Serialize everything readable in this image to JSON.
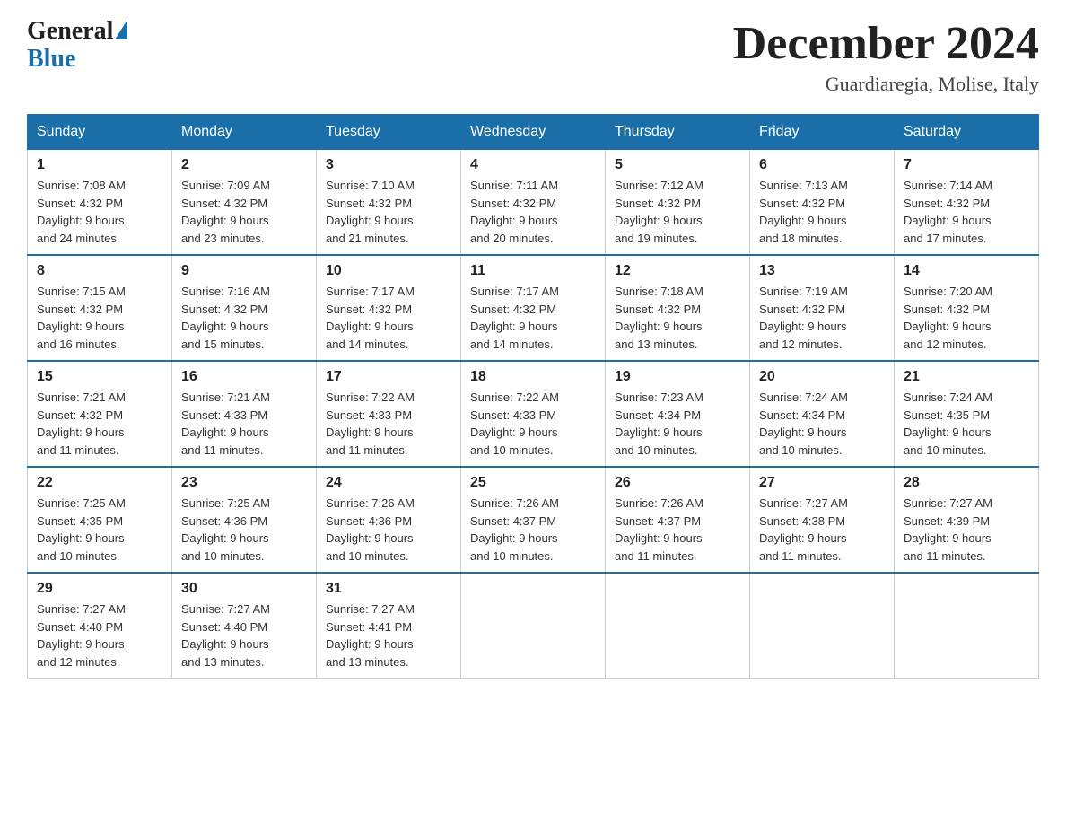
{
  "header": {
    "logo_general": "General",
    "logo_blue": "Blue",
    "month_title": "December 2024",
    "location": "Guardiaregia, Molise, Italy"
  },
  "days_of_week": [
    "Sunday",
    "Monday",
    "Tuesday",
    "Wednesday",
    "Thursday",
    "Friday",
    "Saturday"
  ],
  "weeks": [
    [
      {
        "day": "1",
        "sunrise": "7:08 AM",
        "sunset": "4:32 PM",
        "daylight": "9 hours and 24 minutes."
      },
      {
        "day": "2",
        "sunrise": "7:09 AM",
        "sunset": "4:32 PM",
        "daylight": "9 hours and 23 minutes."
      },
      {
        "day": "3",
        "sunrise": "7:10 AM",
        "sunset": "4:32 PM",
        "daylight": "9 hours and 21 minutes."
      },
      {
        "day": "4",
        "sunrise": "7:11 AM",
        "sunset": "4:32 PM",
        "daylight": "9 hours and 20 minutes."
      },
      {
        "day": "5",
        "sunrise": "7:12 AM",
        "sunset": "4:32 PM",
        "daylight": "9 hours and 19 minutes."
      },
      {
        "day": "6",
        "sunrise": "7:13 AM",
        "sunset": "4:32 PM",
        "daylight": "9 hours and 18 minutes."
      },
      {
        "day": "7",
        "sunrise": "7:14 AM",
        "sunset": "4:32 PM",
        "daylight": "9 hours and 17 minutes."
      }
    ],
    [
      {
        "day": "8",
        "sunrise": "7:15 AM",
        "sunset": "4:32 PM",
        "daylight": "9 hours and 16 minutes."
      },
      {
        "day": "9",
        "sunrise": "7:16 AM",
        "sunset": "4:32 PM",
        "daylight": "9 hours and 15 minutes."
      },
      {
        "day": "10",
        "sunrise": "7:17 AM",
        "sunset": "4:32 PM",
        "daylight": "9 hours and 14 minutes."
      },
      {
        "day": "11",
        "sunrise": "7:17 AM",
        "sunset": "4:32 PM",
        "daylight": "9 hours and 14 minutes."
      },
      {
        "day": "12",
        "sunrise": "7:18 AM",
        "sunset": "4:32 PM",
        "daylight": "9 hours and 13 minutes."
      },
      {
        "day": "13",
        "sunrise": "7:19 AM",
        "sunset": "4:32 PM",
        "daylight": "9 hours and 12 minutes."
      },
      {
        "day": "14",
        "sunrise": "7:20 AM",
        "sunset": "4:32 PM",
        "daylight": "9 hours and 12 minutes."
      }
    ],
    [
      {
        "day": "15",
        "sunrise": "7:21 AM",
        "sunset": "4:32 PM",
        "daylight": "9 hours and 11 minutes."
      },
      {
        "day": "16",
        "sunrise": "7:21 AM",
        "sunset": "4:33 PM",
        "daylight": "9 hours and 11 minutes."
      },
      {
        "day": "17",
        "sunrise": "7:22 AM",
        "sunset": "4:33 PM",
        "daylight": "9 hours and 11 minutes."
      },
      {
        "day": "18",
        "sunrise": "7:22 AM",
        "sunset": "4:33 PM",
        "daylight": "9 hours and 10 minutes."
      },
      {
        "day": "19",
        "sunrise": "7:23 AM",
        "sunset": "4:34 PM",
        "daylight": "9 hours and 10 minutes."
      },
      {
        "day": "20",
        "sunrise": "7:24 AM",
        "sunset": "4:34 PM",
        "daylight": "9 hours and 10 minutes."
      },
      {
        "day": "21",
        "sunrise": "7:24 AM",
        "sunset": "4:35 PM",
        "daylight": "9 hours and 10 minutes."
      }
    ],
    [
      {
        "day": "22",
        "sunrise": "7:25 AM",
        "sunset": "4:35 PM",
        "daylight": "9 hours and 10 minutes."
      },
      {
        "day": "23",
        "sunrise": "7:25 AM",
        "sunset": "4:36 PM",
        "daylight": "9 hours and 10 minutes."
      },
      {
        "day": "24",
        "sunrise": "7:26 AM",
        "sunset": "4:36 PM",
        "daylight": "9 hours and 10 minutes."
      },
      {
        "day": "25",
        "sunrise": "7:26 AM",
        "sunset": "4:37 PM",
        "daylight": "9 hours and 10 minutes."
      },
      {
        "day": "26",
        "sunrise": "7:26 AM",
        "sunset": "4:37 PM",
        "daylight": "9 hours and 11 minutes."
      },
      {
        "day": "27",
        "sunrise": "7:27 AM",
        "sunset": "4:38 PM",
        "daylight": "9 hours and 11 minutes."
      },
      {
        "day": "28",
        "sunrise": "7:27 AM",
        "sunset": "4:39 PM",
        "daylight": "9 hours and 11 minutes."
      }
    ],
    [
      {
        "day": "29",
        "sunrise": "7:27 AM",
        "sunset": "4:40 PM",
        "daylight": "9 hours and 12 minutes."
      },
      {
        "day": "30",
        "sunrise": "7:27 AM",
        "sunset": "4:40 PM",
        "daylight": "9 hours and 13 minutes."
      },
      {
        "day": "31",
        "sunrise": "7:27 AM",
        "sunset": "4:41 PM",
        "daylight": "9 hours and 13 minutes."
      },
      null,
      null,
      null,
      null
    ]
  ],
  "labels": {
    "sunrise": "Sunrise:",
    "sunset": "Sunset:",
    "daylight": "Daylight:"
  }
}
